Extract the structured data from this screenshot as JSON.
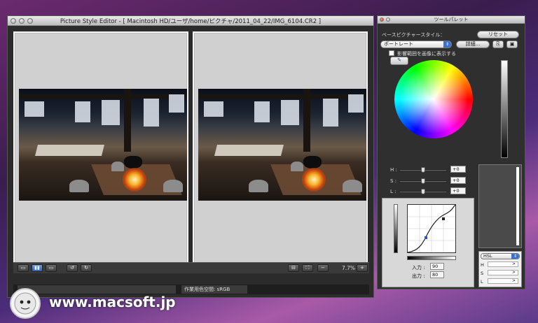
{
  "main_window": {
    "title": "Picture Style Editor - [ Macintosh HD/ユーザ/home/ピクチャ/2011_04_22/IMG_6104.CR2 ]",
    "zoom": "7.7%",
    "toolbar_icons": [
      "single-view-icon",
      "side-by-side-view-icon",
      "split-view-icon",
      "undo-icon",
      "redo-icon",
      "fit-icon",
      "fullscreen-icon",
      "zoom-out-icon",
      "zoom-in-icon"
    ],
    "colorspace_label": "作業用色空間: sRGB"
  },
  "tool_palette": {
    "title": "ツールパレット",
    "base_style_label": "ベースピクチャースタイル：",
    "reset_button": "リセット",
    "style_value": "ポートレート",
    "detail_button": "詳細...",
    "show_area_checkbox": "影響範囲を画像に表示する",
    "sliders": [
      {
        "label": "H :",
        "value": "+0"
      },
      {
        "label": "S :",
        "value": "+0"
      },
      {
        "label": "L :",
        "value": "+0"
      }
    ],
    "curve": {
      "input_label": "入力 :",
      "input_value": "90",
      "output_label": "出力 :",
      "output_value": "80"
    },
    "hsl": {
      "mode": "HSL",
      "rows": [
        {
          "label": "H",
          "arrow": ">"
        },
        {
          "label": "S",
          "arrow": ">"
        },
        {
          "label": "L",
          "arrow": ">"
        }
      ]
    }
  },
  "watermark": "www.macsoft.jp"
}
